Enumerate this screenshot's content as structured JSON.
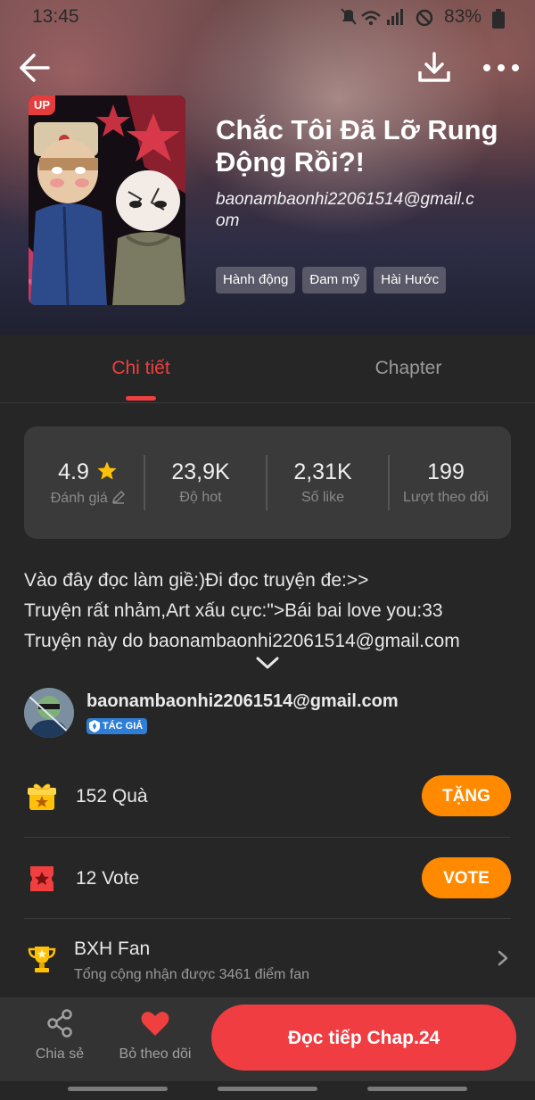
{
  "status_bar": {
    "time": "13:45",
    "battery": "83%"
  },
  "header": {
    "back_icon": "arrow-left-icon",
    "download_icon": "download-icon",
    "more_icon": "more-dots-icon"
  },
  "comic": {
    "cover_badge": "UP",
    "title": "Chắc Tôi Đã Lỡ Rung Động Rồi?!",
    "author_email": "baonambaonhi22061514@gmail.com",
    "tags": [
      "Hành động",
      "Đam mỹ",
      "Hài Hước"
    ]
  },
  "tabs": [
    {
      "label": "Chi tiết",
      "active": true
    },
    {
      "label": "Chapter",
      "active": false
    }
  ],
  "stats": [
    {
      "value": "4.9",
      "label": "Đánh giá",
      "icon": "star-icon",
      "label_icon": "pencil-icon"
    },
    {
      "value": "23,9K",
      "label": "Độ hot"
    },
    {
      "value": "2,31K",
      "label": "Số like"
    },
    {
      "value": "199",
      "label": "Lượt theo dõi"
    }
  ],
  "description": [
    "Vào đây đọc làm giề:)Đi đọc truyện đe:>>",
    "Truyện rất nhảm,Art xấu cực:\">Bái bai love you:33",
    "Truyện này do baonambaonhi22061514@gmail.com"
  ],
  "author": {
    "name": "baonambaonhi22061514@gmail.com",
    "badge": "TÁC GIẢ"
  },
  "gift": {
    "text": "152 Quà",
    "button": "TẶNG",
    "icon": "gift-icon"
  },
  "vote": {
    "text": "12 Vote",
    "button": "VOTE",
    "icon": "ticket-icon"
  },
  "fan_ranking": {
    "title": "BXH Fan",
    "subtitle": "Tổng cộng nhận được 3461 điểm fan",
    "icon": "trophy-icon"
  },
  "bottom_bar": {
    "share_label": "Chia sẻ",
    "unfollow_label": "Bỏ theo dõi",
    "read_button": "Đọc tiếp Chap.24"
  },
  "colors": {
    "accent_red": "#ef3f3f",
    "orange": "#ff8a00",
    "background": "#262626"
  }
}
